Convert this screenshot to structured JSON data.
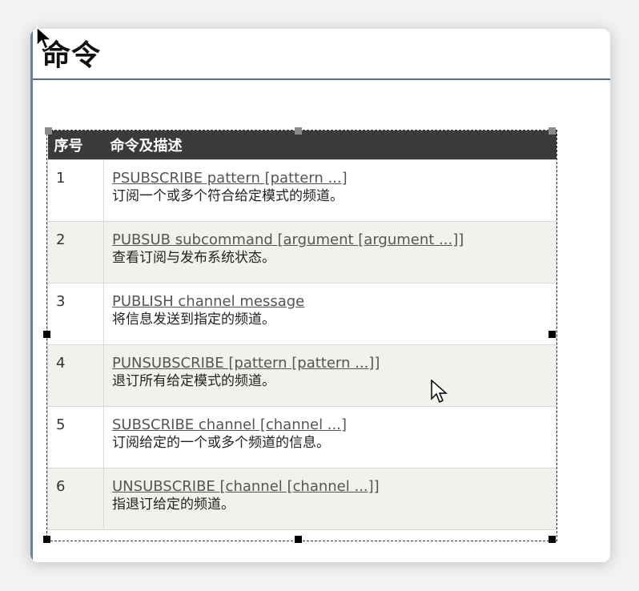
{
  "page": {
    "title": "命令"
  },
  "table": {
    "headers": [
      "序号",
      "命令及描述"
    ],
    "rows": [
      {
        "num": "1",
        "command": "PSUBSCRIBE pattern [pattern ...]",
        "desc": "订阅一个或多个符合给定模式的频道。"
      },
      {
        "num": "2",
        "command": "PUBSUB subcommand [argument [argument ...]]",
        "desc": "查看订阅与发布系统状态。"
      },
      {
        "num": "3",
        "command": "PUBLISH channel message",
        "desc": "将信息发送到指定的频道。"
      },
      {
        "num": "4",
        "command": "PUNSUBSCRIBE [pattern [pattern ...]]",
        "desc": "退订所有给定模式的频道。"
      },
      {
        "num": "5",
        "command": "SUBSCRIBE channel [channel ...]",
        "desc": "订阅给定的一个或多个频道的信息。"
      },
      {
        "num": "6",
        "command": "UNSUBSCRIBE [channel [channel ...]]",
        "desc": "指退订给定的频道。"
      }
    ]
  },
  "colors": {
    "header_bg": "#3b3b3b",
    "even_row_bg": "#f3f1ec",
    "link": "#555555"
  },
  "icons": [
    "mouse-pointer-icon",
    "selection-handle-icon"
  ]
}
